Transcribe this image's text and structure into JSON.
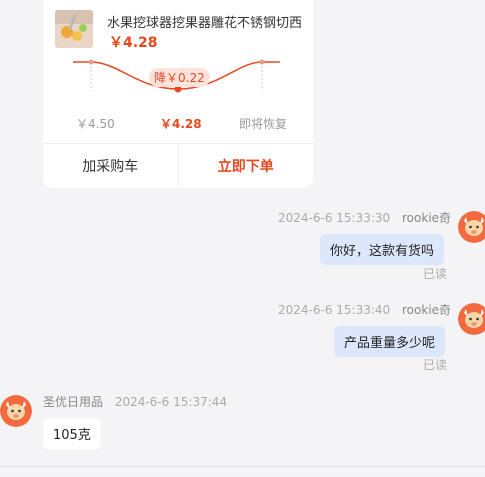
{
  "product_card": {
    "title": "水果挖球器挖果器雕花不锈钢切西",
    "price": "￥4.28",
    "trend": {
      "drop_label": "降￥0.22",
      "old_price": "￥4.50",
      "current_price": "￥4.28",
      "upcoming_label": "即将恢复",
      "color": "#e8481f"
    },
    "add_to_cart": "加采购车",
    "order_now": "立即下单"
  },
  "messages": [
    {
      "sender": "rookie奇",
      "time": "2024-6-6 15:33:30",
      "text": "你好，这款有货吗",
      "status": "已读",
      "side": "right"
    },
    {
      "sender": "rookie奇",
      "time": "2024-6-6 15:33:40",
      "text": "产品重量多少呢",
      "status": "已读",
      "side": "right"
    },
    {
      "sender": "圣优日用品",
      "time": "2024-6-6 15:37:44",
      "text": "105克",
      "side": "left"
    }
  ],
  "colors": {
    "accent": "#e8481f",
    "my_bubble": "#dce7fb",
    "background": "#f4f4f6"
  }
}
